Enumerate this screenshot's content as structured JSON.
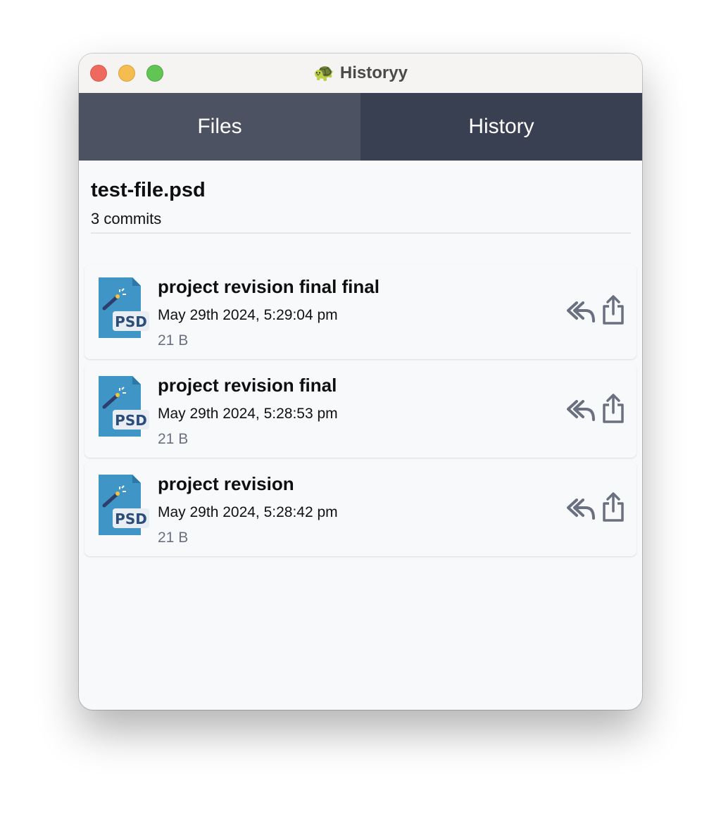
{
  "window": {
    "title": "Historyy",
    "title_emoji": "🐢"
  },
  "tabs": [
    {
      "label": "Files",
      "active": false
    },
    {
      "label": "History",
      "active": true
    }
  ],
  "file": {
    "name": "test-file.psd",
    "commit_count": "3 commits"
  },
  "commits": [
    {
      "message": "project revision final final",
      "date": "May 29th 2024, 5:29:04 pm",
      "size": "21 B",
      "icon": "psd-file-icon"
    },
    {
      "message": "project revision final",
      "date": "May 29th 2024, 5:28:53 pm",
      "size": "21 B",
      "icon": "psd-file-icon"
    },
    {
      "message": "project revision",
      "date": "May 29th 2024, 5:28:42 pm",
      "size": "21 B",
      "icon": "psd-file-icon"
    }
  ],
  "icons": {
    "psd_badge_text": "PSD",
    "revert": "reply-all-icon",
    "share": "share-icon"
  },
  "colors": {
    "tab_inactive": "#4c5261",
    "tab_active": "#394051",
    "psd_blue": "#3f96c6",
    "action_icon": "#6b7080"
  }
}
